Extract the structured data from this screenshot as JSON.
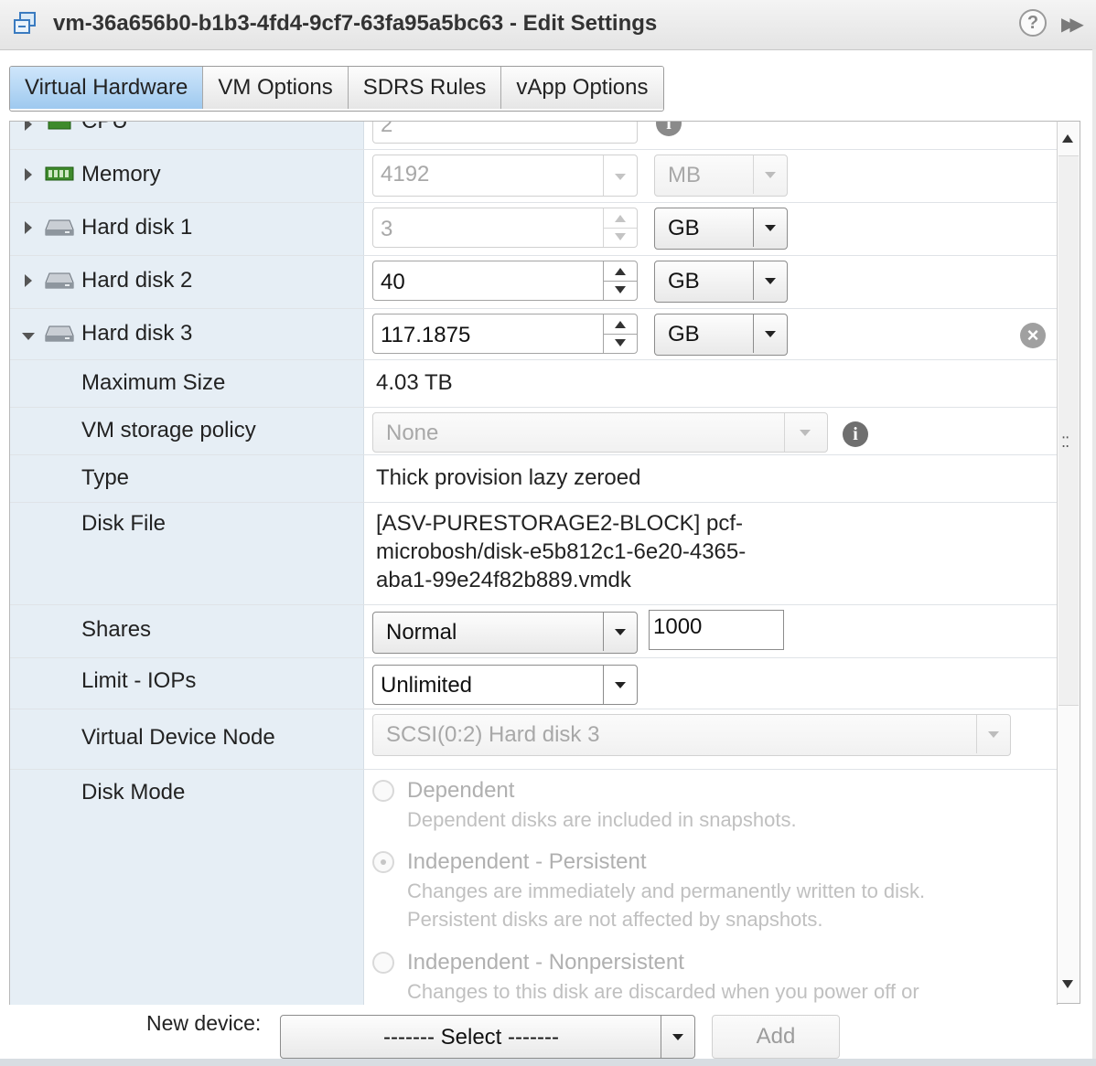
{
  "window": {
    "title": "vm-36a656b0-b1b3-4fd4-9cf7-63fa95a5bc63 - Edit Settings"
  },
  "tabs": [
    {
      "label": "Virtual Hardware",
      "active": true
    },
    {
      "label": "VM Options",
      "active": false
    },
    {
      "label": "SDRS Rules",
      "active": false
    },
    {
      "label": "vApp Options",
      "active": false
    }
  ],
  "hardware": {
    "cpu": {
      "label": "CPU",
      "value": "2"
    },
    "memory": {
      "label": "Memory",
      "value": "4192",
      "unit": "MB"
    },
    "hard_disk_1": {
      "label": "Hard disk 1",
      "value": "3",
      "unit": "GB"
    },
    "hard_disk_2": {
      "label": "Hard disk 2",
      "value": "40",
      "unit": "GB"
    },
    "hard_disk_3": {
      "label": "Hard disk 3",
      "value": "117.1875",
      "unit": "GB",
      "expanded": true
    }
  },
  "disk3_details": {
    "max_size": {
      "label": "Maximum Size",
      "value": "4.03 TB"
    },
    "storage_policy": {
      "label": "VM storage policy",
      "value": "None"
    },
    "type": {
      "label": "Type",
      "value": "Thick provision lazy zeroed"
    },
    "disk_file": {
      "label": "Disk File",
      "value": "[ASV-PURESTORAGE2-BLOCK] pcf-microbosh/disk-e5b812c1-6e20-4365-aba1-99e24f82b889.vmdk"
    },
    "shares": {
      "label": "Shares",
      "value": "Normal",
      "number": "1000"
    },
    "limit_iops": {
      "label": "Limit - IOPs",
      "value": "Unlimited"
    },
    "device_node": {
      "label": "Virtual Device Node",
      "value": "SCSI(0:2) Hard disk 3"
    },
    "disk_mode": {
      "label": "Disk Mode",
      "options": [
        {
          "label": "Dependent",
          "desc1": "Dependent disks are included in snapshots.",
          "desc2": "",
          "selected": false
        },
        {
          "label": "Independent - Persistent",
          "desc1": "Changes are immediately and permanently written to disk.",
          "desc2": "Persistent disks are not affected by snapshots.",
          "selected": true
        },
        {
          "label": "Independent - Nonpersistent",
          "desc1": "Changes to this disk are discarded when you power off or",
          "desc2": "",
          "selected": false
        }
      ]
    }
  },
  "footer": {
    "new_device_label": "New device:",
    "select_value": "------- Select -------",
    "add_label": "Add"
  },
  "icons": {
    "window": "vm-icon",
    "help": "help-icon",
    "collapse": "double-chevron-right-icon",
    "info": "info-icon",
    "remove": "remove-circle-icon"
  }
}
